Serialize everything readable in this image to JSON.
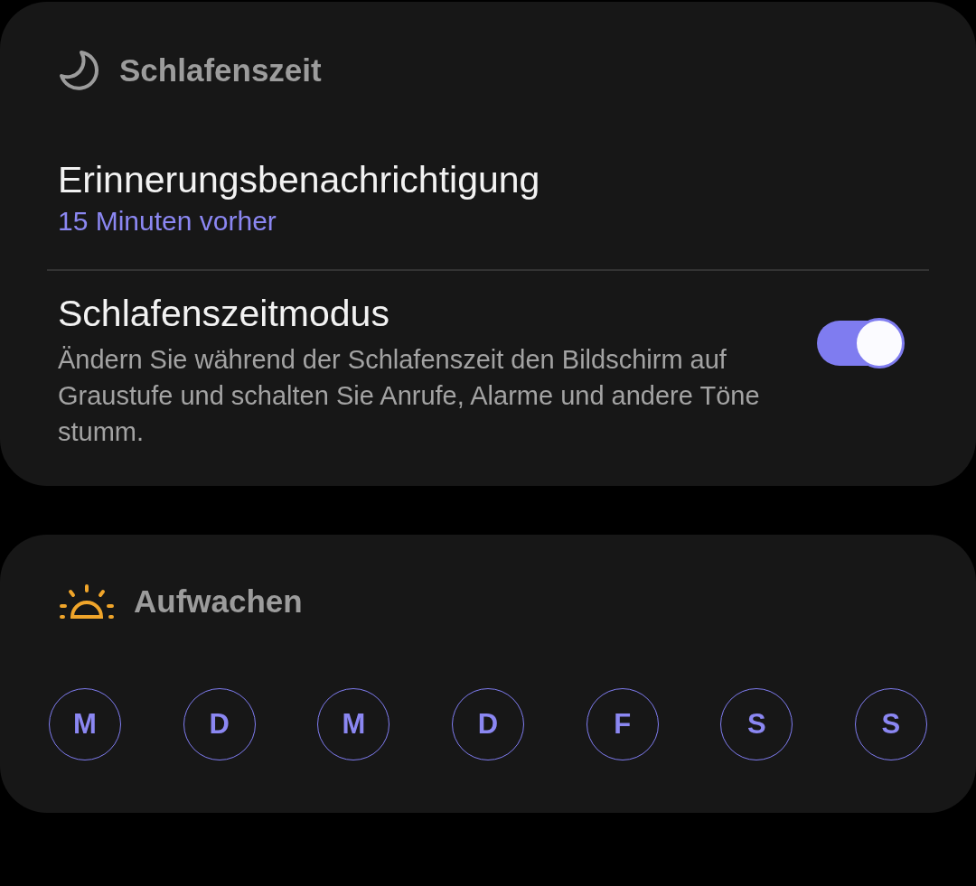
{
  "bedtime": {
    "title": "Schlafenszeit",
    "reminder": {
      "title": "Erinnerungsbenachrichtigung",
      "value": "15 Minuten vorher"
    },
    "mode": {
      "title": "Schlafenszeitmodus",
      "description": "Ändern Sie während der Schlafenszeit den Bildschirm auf Graustufe und schalten Sie Anrufe, Alarme und andere Töne stumm.",
      "on": true
    }
  },
  "wake": {
    "title": "Aufwachen",
    "days": [
      {
        "label": "M",
        "selected": false
      },
      {
        "label": "D",
        "selected": false
      },
      {
        "label": "M",
        "selected": false
      },
      {
        "label": "D",
        "selected": false
      },
      {
        "label": "F",
        "selected": false
      },
      {
        "label": "S",
        "selected": false
      },
      {
        "label": "S",
        "selected": false
      }
    ]
  }
}
